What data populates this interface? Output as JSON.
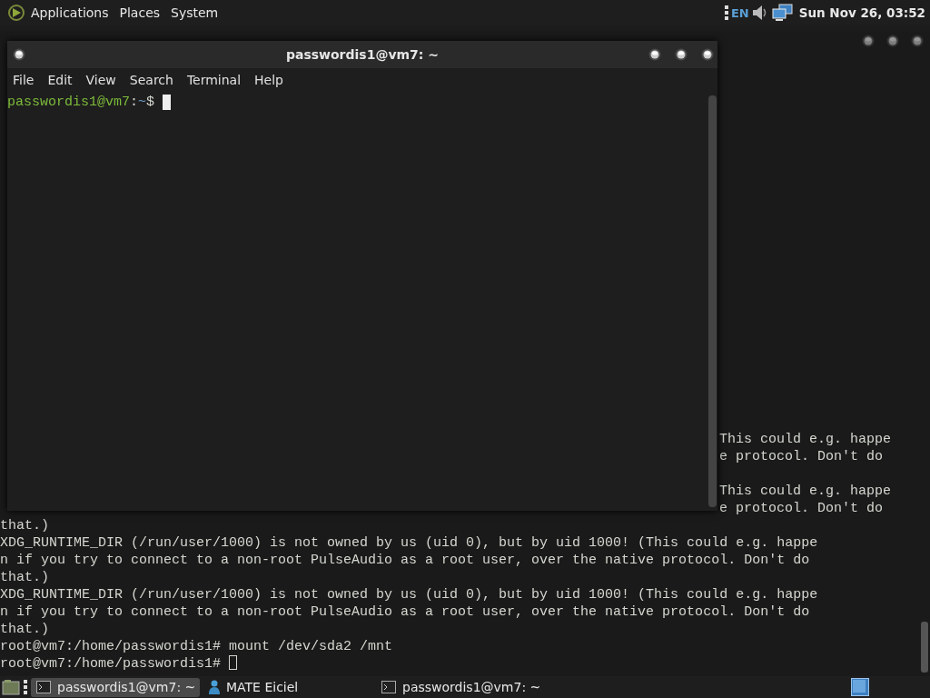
{
  "top_panel": {
    "menus": [
      "Applications",
      "Places",
      "System"
    ],
    "keyboard_layout": "EN",
    "clock": "Sun Nov 26, 03:52"
  },
  "background_terminal": {
    "lines": [
      {
        "kind": "fragment",
        "text": "This could e.g. happe"
      },
      {
        "kind": "fragment",
        "text": "e protocol. Don't do"
      },
      {
        "kind": "blank"
      },
      {
        "kind": "fragment",
        "text": "This could e.g. happe"
      },
      {
        "kind": "fragment",
        "text": "e protocol. Don't do"
      },
      {
        "kind": "full",
        "text": "that.)"
      },
      {
        "kind": "full",
        "text": "XDG_RUNTIME_DIR (/run/user/1000) is not owned by us (uid 0), but by uid 1000! (This could e.g. happe"
      },
      {
        "kind": "full",
        "text": "n if you try to connect to a non-root PulseAudio as a root user, over the native protocol. Don't do"
      },
      {
        "kind": "full",
        "text": "that.)"
      },
      {
        "kind": "full",
        "text": "XDG_RUNTIME_DIR (/run/user/1000) is not owned by us (uid 0), but by uid 1000! (This could e.g. happe"
      },
      {
        "kind": "full",
        "text": "n if you try to connect to a non-root PulseAudio as a root user, over the native protocol. Don't do"
      },
      {
        "kind": "full",
        "text": "that.)"
      },
      {
        "kind": "full",
        "text": "root@vm7:/home/passwordis1# mount /dev/sda2 /mnt"
      },
      {
        "kind": "prompt",
        "text": "root@vm7:/home/passwordis1# "
      }
    ]
  },
  "terminal_window": {
    "title": "passwordis1@vm7: ~",
    "menu": [
      "File",
      "Edit",
      "View",
      "Search",
      "Terminal",
      "Help"
    ],
    "prompt": {
      "user_host": "passwordis1@vm7",
      "separator": ":",
      "path": "~",
      "symbol": "$ "
    }
  },
  "taskbar": [
    {
      "label": "passwordis1@vm7: ~",
      "kind": "terminal",
      "selected": true
    },
    {
      "label": "MATE Eiciel",
      "kind": "user",
      "selected": false
    },
    {
      "label": "passwordis1@vm7: ~",
      "kind": "terminal",
      "selected": false
    }
  ]
}
